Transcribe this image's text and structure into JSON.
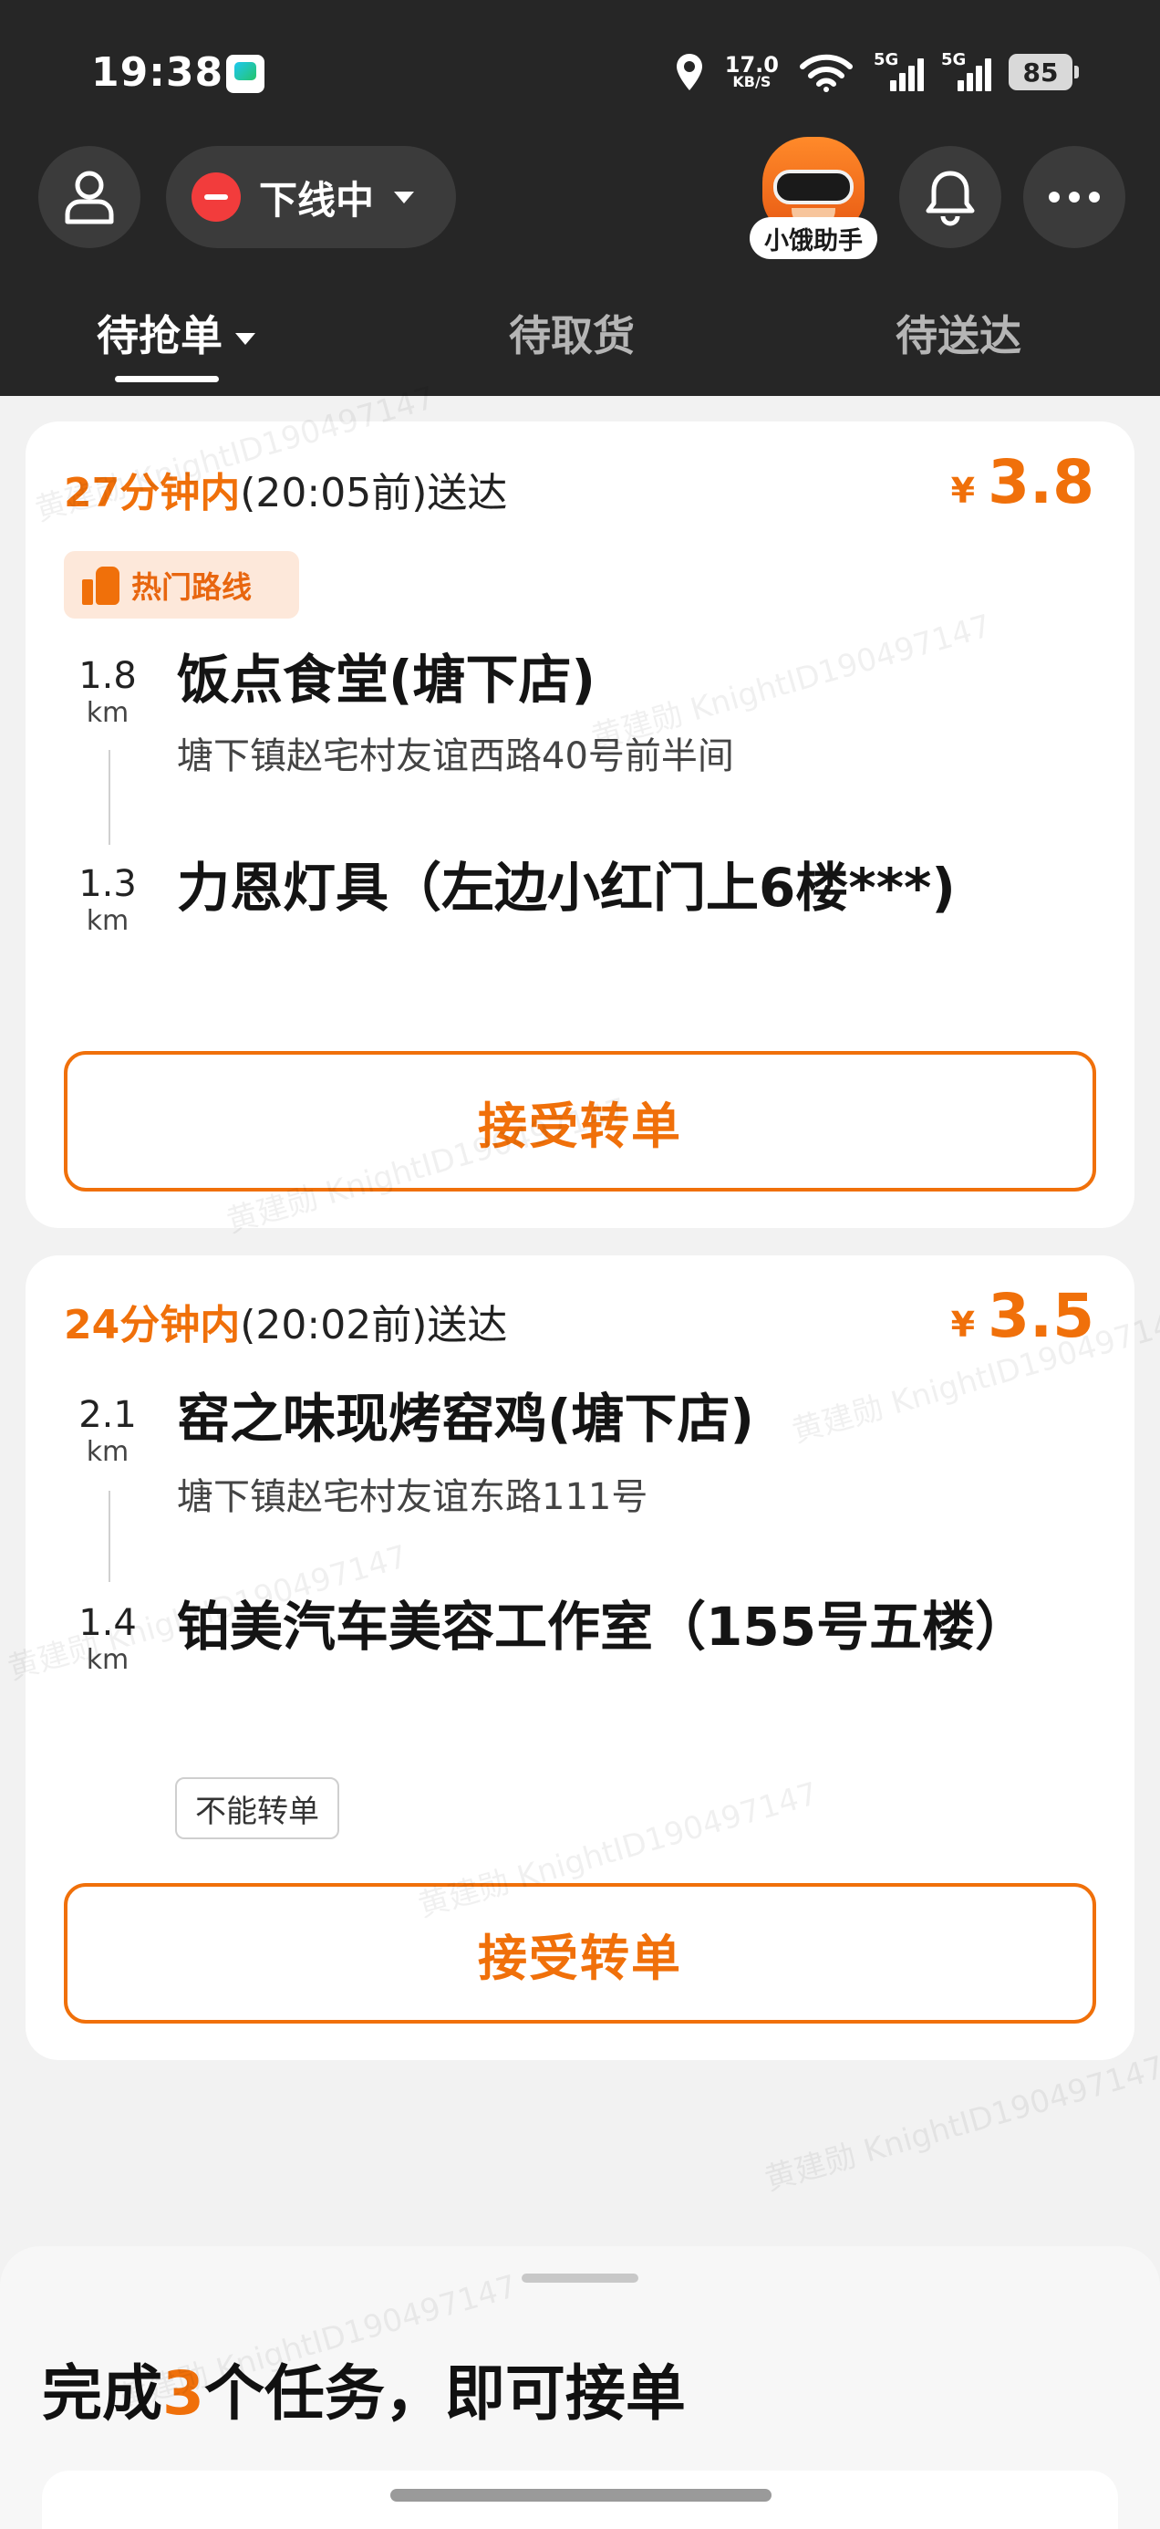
{
  "status_bar": {
    "time": "19:38",
    "net_speed": "17.0",
    "net_speed_unit": "KB/S",
    "signal_1_label": "5G",
    "signal_2_label": "5G",
    "battery": "85"
  },
  "header": {
    "status_label": "下线中",
    "assistant_label": "小饿助手"
  },
  "tabs": [
    {
      "label": "待抢单",
      "active": true
    },
    {
      "label": "待取货",
      "active": false
    },
    {
      "label": "待送达",
      "active": false
    }
  ],
  "orders": [
    {
      "eta_highlight": "27分钟内",
      "eta_rest": "(20:05前)送达",
      "currency": "¥",
      "price": "3.8",
      "badge": "热门路线",
      "pickup": {
        "distance": "1.8",
        "unit": "km",
        "name": "饭点食堂(塘下店)",
        "address": "塘下镇赵宅村友谊西路40号前半间"
      },
      "dropoff": {
        "distance": "1.3",
        "unit": "km",
        "name": "力恩灯具（左边小红门上6楼***)"
      },
      "action": "接受转单"
    },
    {
      "eta_highlight": "24分钟内",
      "eta_rest": "(20:02前)送达",
      "currency": "¥",
      "price": "3.5",
      "pickup": {
        "distance": "2.1",
        "unit": "km",
        "name": "窑之味现烤窑鸡(塘下店)",
        "address": "塘下镇赵宅村友谊东路111号"
      },
      "dropoff": {
        "distance": "1.4",
        "unit": "km",
        "name": "铂美汽车美容工作室（155号五楼）"
      },
      "tag": "不能转单",
      "action": "接受转单"
    }
  ],
  "bottom_sheet": {
    "task_prefix": "完成",
    "task_count": "3",
    "task_suffix": "个任务，即可接单"
  },
  "watermark_text": "黄建勋 KnightID190497147",
  "colors": {
    "accent": "#f0700a",
    "header_bg": "#262626",
    "offline_red": "#f23c3c"
  }
}
